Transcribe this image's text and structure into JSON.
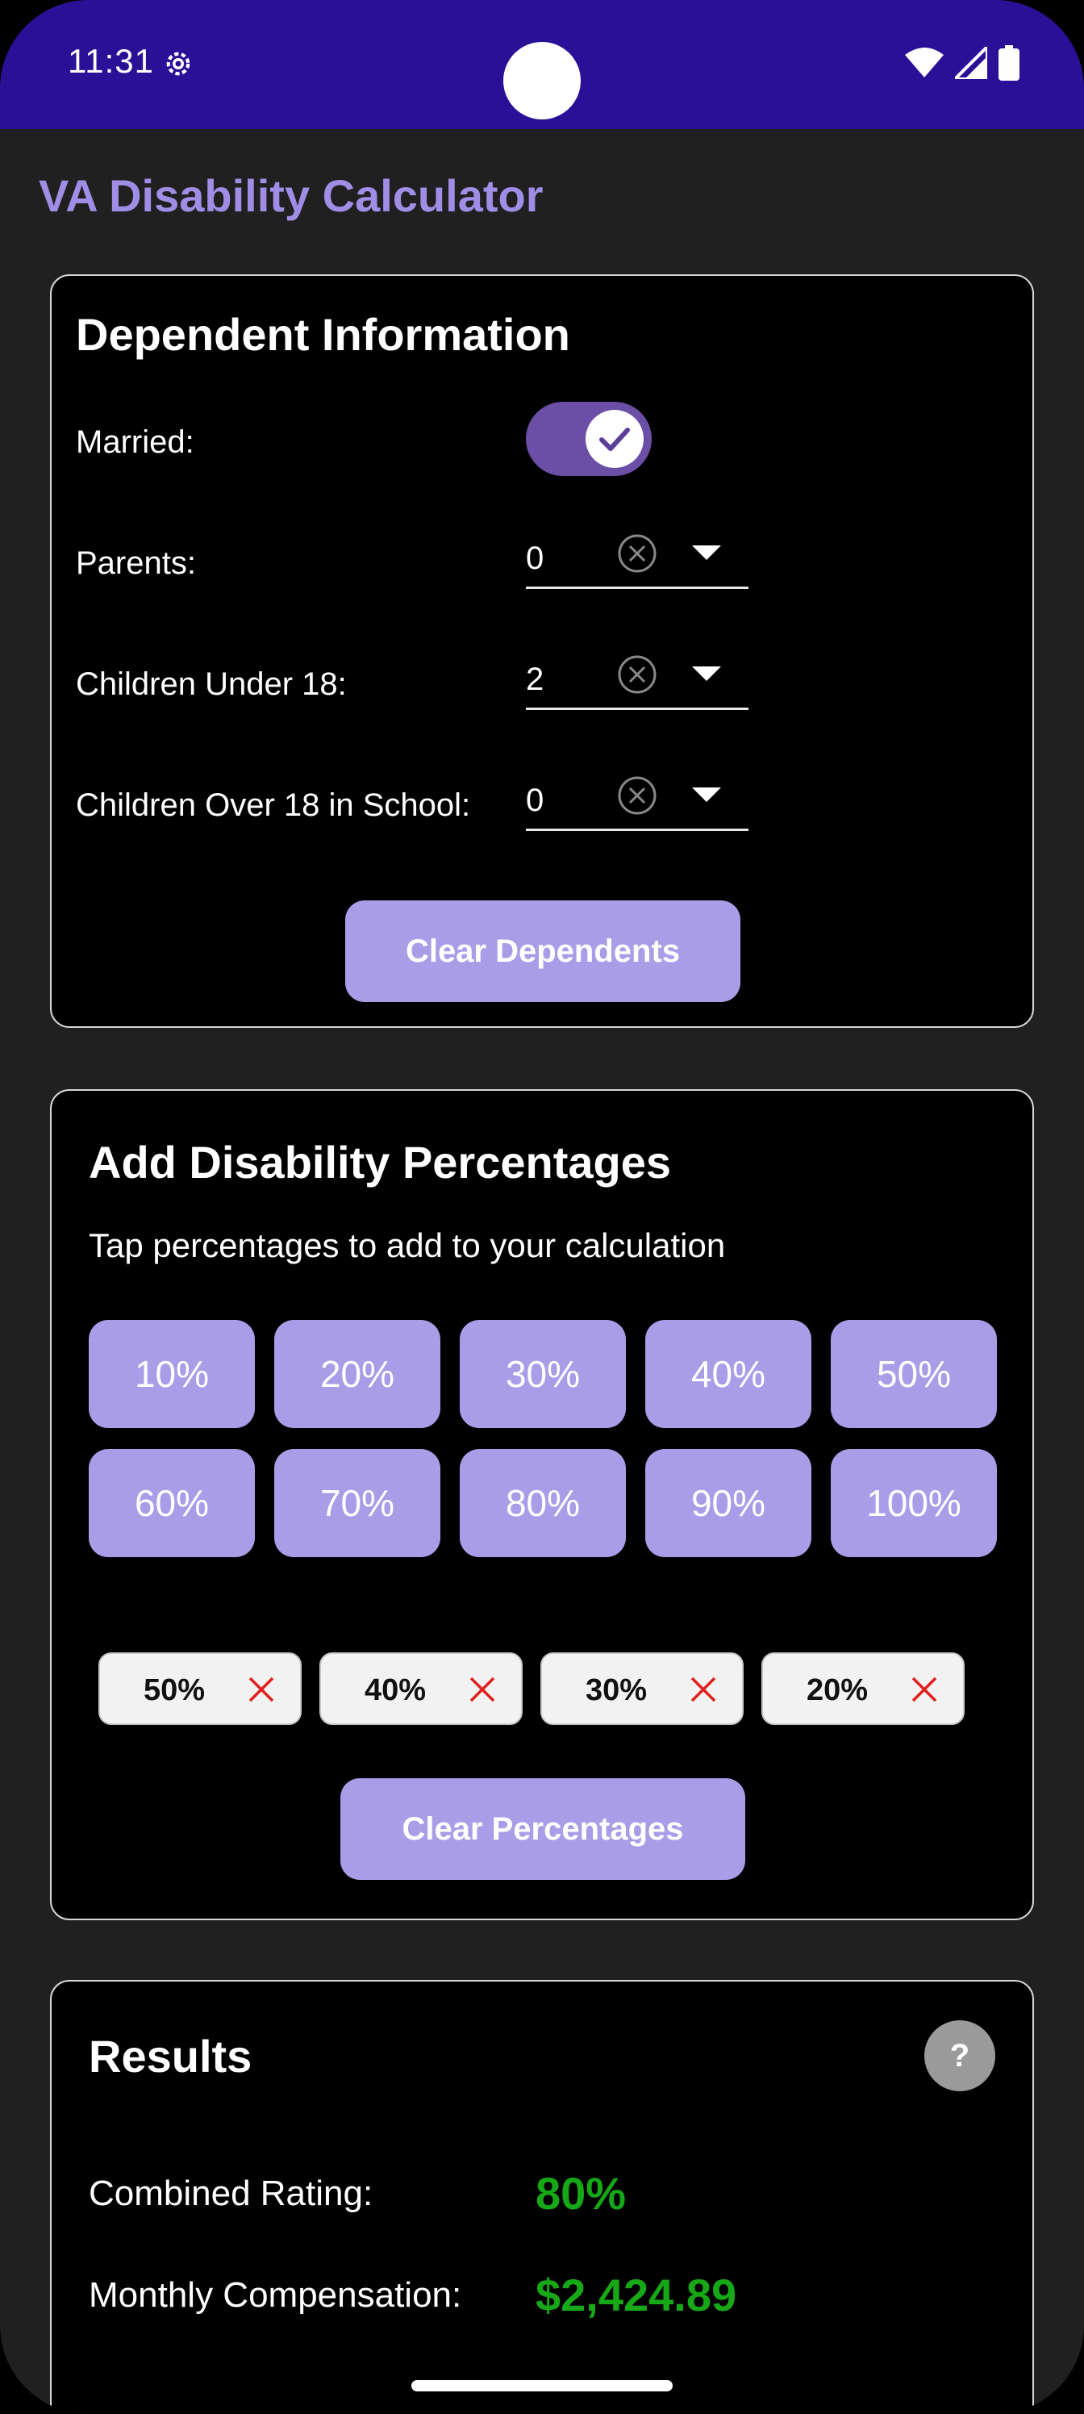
{
  "status_bar": {
    "time": "11:31"
  },
  "app": {
    "title": "VA Disability Calculator"
  },
  "dependents": {
    "heading": "Dependent Information",
    "married_label": "Married:",
    "parents_label": "Parents:",
    "parents_value": "0",
    "children_under_18_label": "Children Under 18:",
    "children_under_18_value": "2",
    "children_over_18_label": "Children Over 18 in School:",
    "children_over_18_value": "0",
    "clear_label": "Clear Dependents"
  },
  "disability": {
    "heading": "Add Disability Percentages",
    "subtext": "Tap percentages to add to your calculation",
    "options": [
      "10%",
      "20%",
      "30%",
      "40%",
      "50%",
      "60%",
      "70%",
      "80%",
      "90%",
      "100%"
    ],
    "selected": [
      "50%",
      "40%",
      "30%",
      "20%"
    ],
    "clear_label": "Clear Percentages"
  },
  "results": {
    "heading": "Results",
    "help_label": "?",
    "combined_label": "Combined Rating:",
    "combined_value": "80%",
    "monthly_label": "Monthly Compensation:",
    "monthly_value": "$2,424.89"
  },
  "colors": {
    "status_bar": "#2a1096",
    "accent": "#a99de8",
    "title": "#a08ee6",
    "result_value": "#17a817"
  }
}
